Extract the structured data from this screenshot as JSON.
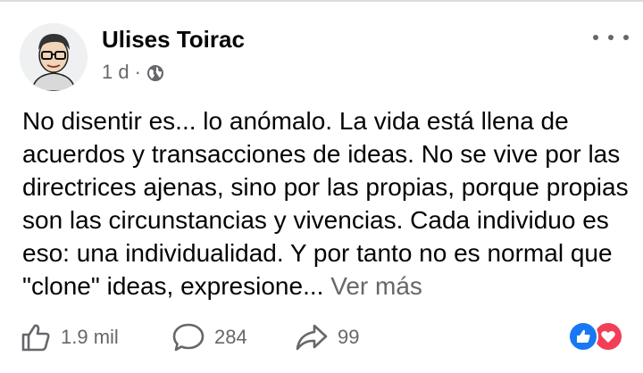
{
  "post": {
    "author": "Ulises Toirac",
    "time": "1 d",
    "separator": "·",
    "visibility_icon": "globe-icon",
    "more_icon": "more-dots-icon",
    "text": "No disentir es... lo anómalo. La vida está llena de acuerdos y transacciones de ideas. No se vive por las directrices ajenas, sino por las propias, porque propias son las circunstancias y vivencias. Cada individuo es eso: una individualidad. Y por tanto no es normal que \"clone\" ideas, expresione...",
    "see_more": "Ver más"
  },
  "actions": {
    "like_count": "1.9 mil",
    "comment_count": "284",
    "share_count": "99"
  },
  "reactions": [
    "like",
    "love"
  ],
  "colors": {
    "like_blue": "#1877f2",
    "love_red": "#f33e58",
    "secondary_text": "#65676b"
  }
}
